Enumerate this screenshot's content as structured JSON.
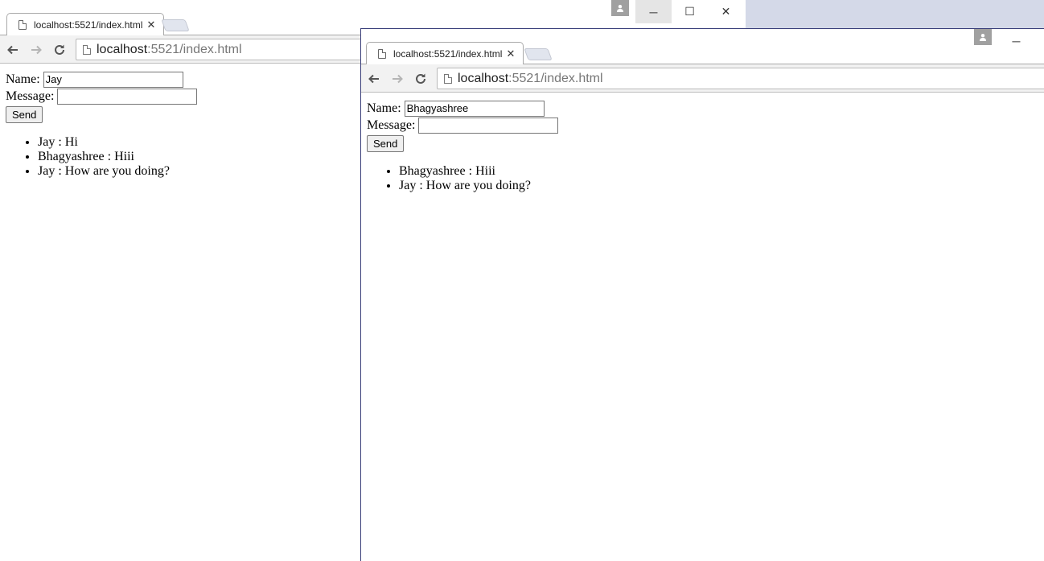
{
  "windows": [
    {
      "tab_title": "localhost:5521/index.html",
      "url_host": "localhost",
      "url_path": ":5521/index.html",
      "form": {
        "name_label": "Name:",
        "name_value": "Jay",
        "message_label": "Message:",
        "message_value": "",
        "send_label": "Send"
      },
      "messages": [
        "Jay : Hi",
        "Bhagyashree : Hiii",
        "Jay : How are you doing?"
      ]
    },
    {
      "tab_title": "localhost:5521/index.html",
      "url_host": "localhost",
      "url_path": ":5521/index.html",
      "form": {
        "name_label": "Name:",
        "name_value": "Bhagyashree",
        "message_label": "Message:",
        "message_value": "",
        "send_label": "Send"
      },
      "messages": [
        "Bhagyashree : Hiii",
        "Jay : How are you doing?"
      ]
    }
  ],
  "icons": {
    "tab_close": "✕",
    "minimize": "─",
    "maximize": "☐",
    "close": "✕"
  }
}
